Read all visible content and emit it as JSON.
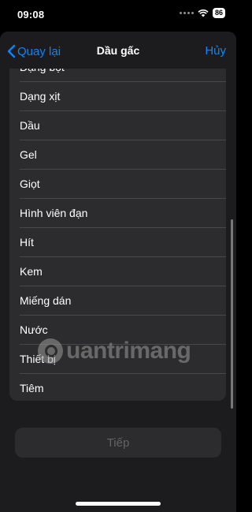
{
  "status": {
    "time": "09:08",
    "battery": "86"
  },
  "nav": {
    "back_label": "Quay lại",
    "title": "Dầu gấc",
    "cancel_label": "Hủy"
  },
  "list": {
    "items": [
      "Dạng bột",
      "Dạng xịt",
      "Dầu",
      "Gel",
      "Giọt",
      "Hình viên đạn",
      "Hít",
      "Kem",
      "Miếng dán",
      "Nước",
      "Thiết bị",
      "Tiêm"
    ]
  },
  "watermark": {
    "text": "uantrimang"
  },
  "footer": {
    "continue_label": "Tiếp"
  },
  "colors": {
    "accent": "#0a84ff",
    "background": "#000000",
    "sheet": "#1c1c1e",
    "card": "#2c2c2e"
  }
}
